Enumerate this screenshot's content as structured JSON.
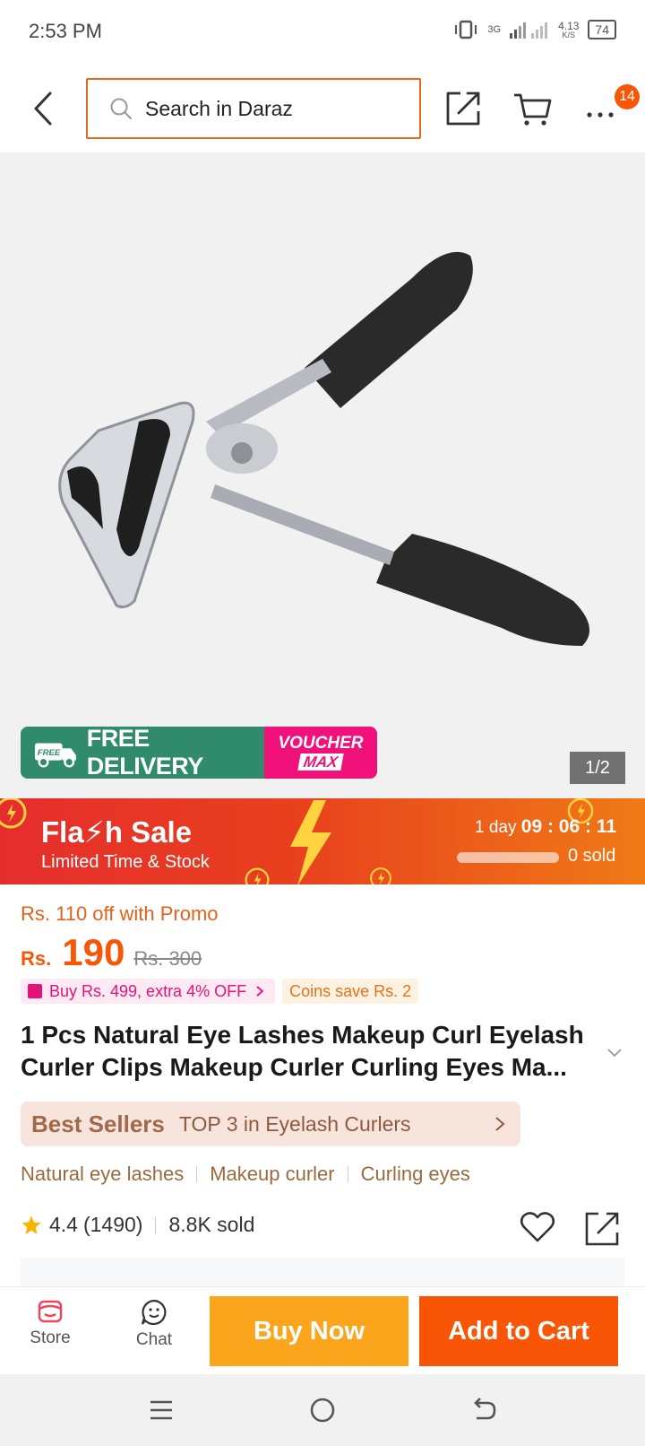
{
  "status_bar": {
    "time": "2:53 PM",
    "network": "3G",
    "speed_value": "4.13",
    "speed_unit": "K/S",
    "battery": "74"
  },
  "header": {
    "search_placeholder": "Search in Daraz",
    "more_badge": "14"
  },
  "gallery": {
    "promo_free_label": "FREE",
    "promo_free_delivery": "FREE DELIVERY",
    "promo_voucher_top": "VOUCHER",
    "promo_voucher_bottom": "MAX",
    "image_counter": "1/2"
  },
  "flash_sale": {
    "title": "Fla⚡h Sale",
    "subtitle": "Limited Time & Stock",
    "timer_prefix": "1 day",
    "timer": "09 : 06 : 11",
    "sold": "0 sold",
    "sold_progress": 0
  },
  "pricing": {
    "promo_off": "Rs. 110 off with Promo",
    "currency": "Rs.",
    "price": "190",
    "original_price": "Rs. 300",
    "tag_buy": "Buy Rs. 499, extra 4% OFF",
    "tag_coins": "Coins save Rs. 2"
  },
  "product": {
    "title": "1 Pcs Natural Eye Lashes Makeup Curl Eyelash Curler Clips Makeup Curler Curling Eyes Ma...",
    "best_sellers_label": "Best Sellers",
    "best_sellers_rank": "TOP 3 in Eyelash Curlers",
    "keywords": [
      "Natural eye lashes",
      "Makeup curler",
      "Curling eyes"
    ],
    "rating": "4.4",
    "rating_count": "(1490)",
    "sold": "8.8K sold"
  },
  "bottom_bar": {
    "store_label": "Store",
    "chat_label": "Chat",
    "buy_now_label": "Buy Now",
    "add_to_cart_label": "Add to Cart"
  },
  "colors": {
    "brand_orange": "#f85606",
    "buy_now_yellow": "#fba51d",
    "search_border": "#e46a1a",
    "voucher_pink": "#f0117a",
    "free_delivery_green": "#2f8b6b"
  }
}
